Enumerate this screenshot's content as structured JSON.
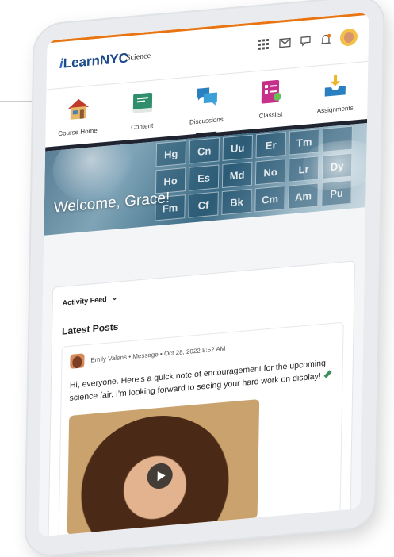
{
  "header": {
    "brand_prefix": "i",
    "brand_main": "LearnNYC",
    "course_name": "Science"
  },
  "topbar_icons": [
    "apps-grid-icon",
    "mail-icon",
    "chat-icon",
    "bell-icon",
    "user-avatar"
  ],
  "nav": [
    {
      "label": "Course Home",
      "icon": "house-icon"
    },
    {
      "label": "Content",
      "icon": "book-icon"
    },
    {
      "label": "Discussions",
      "icon": "chat-bubbles-icon"
    },
    {
      "label": "Classlist",
      "icon": "checklist-icon"
    },
    {
      "label": "Assignments",
      "icon": "inbox-upload-icon"
    }
  ],
  "hero": {
    "welcome": "Welcome, Grace!",
    "tiles": [
      "Hg",
      "Cn",
      "Uu",
      "Er",
      "Tm",
      "",
      "Ho",
      "Es",
      "Md",
      "No",
      "Lr",
      "Dy",
      "Fm",
      "Cf",
      "Bk",
      "Cm",
      "Am",
      "Pu"
    ]
  },
  "feed": {
    "selector_label": "Activity Feed",
    "section_title": "Latest Posts",
    "post": {
      "author": "Emily Valens",
      "type": "Message",
      "timestamp": "Oct 28, 2022 8:52 AM",
      "body": "Hi, everyone. Here's a quick note of encouragement for the upcoming science fair. I'm looking forward to seeing your hard work on display!"
    }
  },
  "colors": {
    "accent": "#e87511",
    "brand": "#1c4a8a",
    "nav_dark": "#1f2430"
  }
}
